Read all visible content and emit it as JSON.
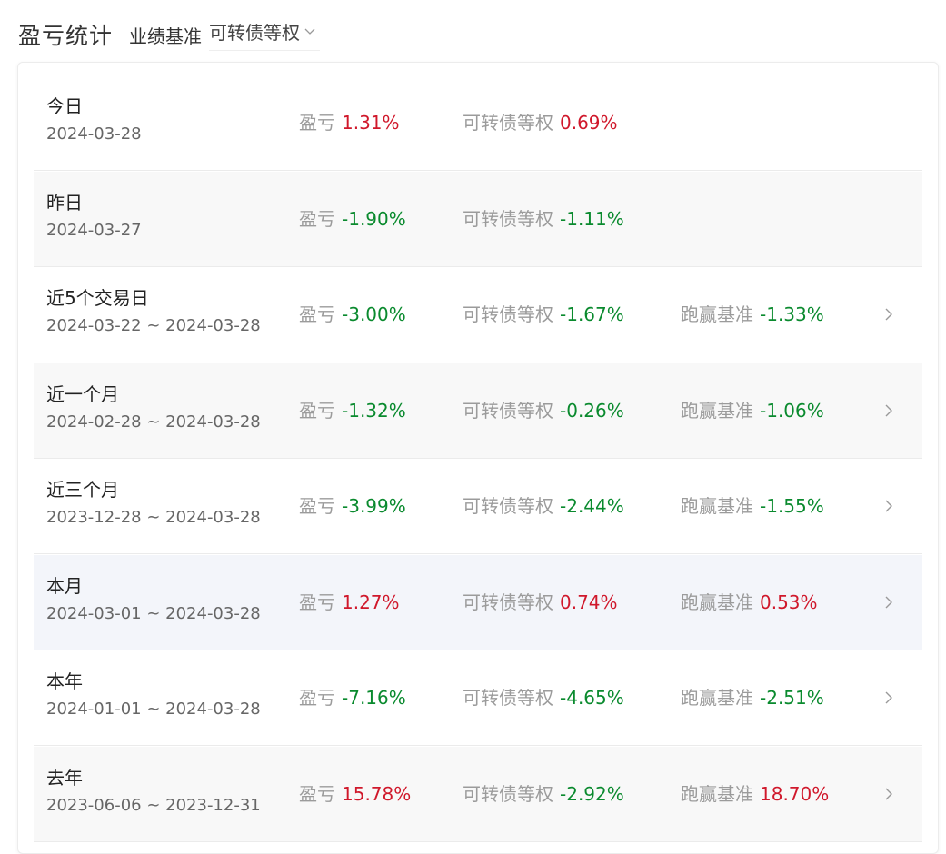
{
  "header": {
    "title": "盈亏统计",
    "benchmark_label": "业绩基准",
    "benchmark_value": "可转债等权"
  },
  "colors": {
    "up": "#d0182b",
    "down": "#0a8a2e",
    "label": "#9b9b9b"
  },
  "rows": [
    {
      "period": "今日",
      "dates": "2024-03-28",
      "pnl_label": "盈亏",
      "pnl": "1.31%",
      "bench_label": "可转债等权",
      "bench": "0.69%",
      "excess_label": "",
      "excess": "",
      "has_arrow": false
    },
    {
      "period": "昨日",
      "dates": "2024-03-27",
      "pnl_label": "盈亏",
      "pnl": "-1.90%",
      "bench_label": "可转债等权",
      "bench": "-1.11%",
      "excess_label": "",
      "excess": "",
      "has_arrow": false
    },
    {
      "period": "近5个交易日",
      "dates": "2024-03-22 ~ 2024-03-28",
      "pnl_label": "盈亏",
      "pnl": "-3.00%",
      "bench_label": "可转债等权",
      "bench": "-1.67%",
      "excess_label": "跑赢基准",
      "excess": "-1.33%",
      "has_arrow": true
    },
    {
      "period": "近一个月",
      "dates": "2024-02-28 ~ 2024-03-28",
      "pnl_label": "盈亏",
      "pnl": "-1.32%",
      "bench_label": "可转债等权",
      "bench": "-0.26%",
      "excess_label": "跑赢基准",
      "excess": "-1.06%",
      "has_arrow": true
    },
    {
      "period": "近三个月",
      "dates": "2023-12-28 ~ 2024-03-28",
      "pnl_label": "盈亏",
      "pnl": "-3.99%",
      "bench_label": "可转债等权",
      "bench": "-2.44%",
      "excess_label": "跑赢基准",
      "excess": "-1.55%",
      "has_arrow": true
    },
    {
      "period": "本月",
      "dates": "2024-03-01 ~ 2024-03-28",
      "pnl_label": "盈亏",
      "pnl": "1.27%",
      "bench_label": "可转债等权",
      "bench": "0.74%",
      "excess_label": "跑赢基准",
      "excess": "0.53%",
      "has_arrow": true
    },
    {
      "period": "本年",
      "dates": "2024-01-01 ~ 2024-03-28",
      "pnl_label": "盈亏",
      "pnl": "-7.16%",
      "bench_label": "可转债等权",
      "bench": "-4.65%",
      "excess_label": "跑赢基准",
      "excess": "-2.51%",
      "has_arrow": true
    },
    {
      "period": "去年",
      "dates": "2023-06-06 ~ 2023-12-31",
      "pnl_label": "盈亏",
      "pnl": "15.78%",
      "bench_label": "可转债等权",
      "bench": "-2.92%",
      "excess_label": "跑赢基准",
      "excess": "18.70%",
      "has_arrow": true
    }
  ]
}
